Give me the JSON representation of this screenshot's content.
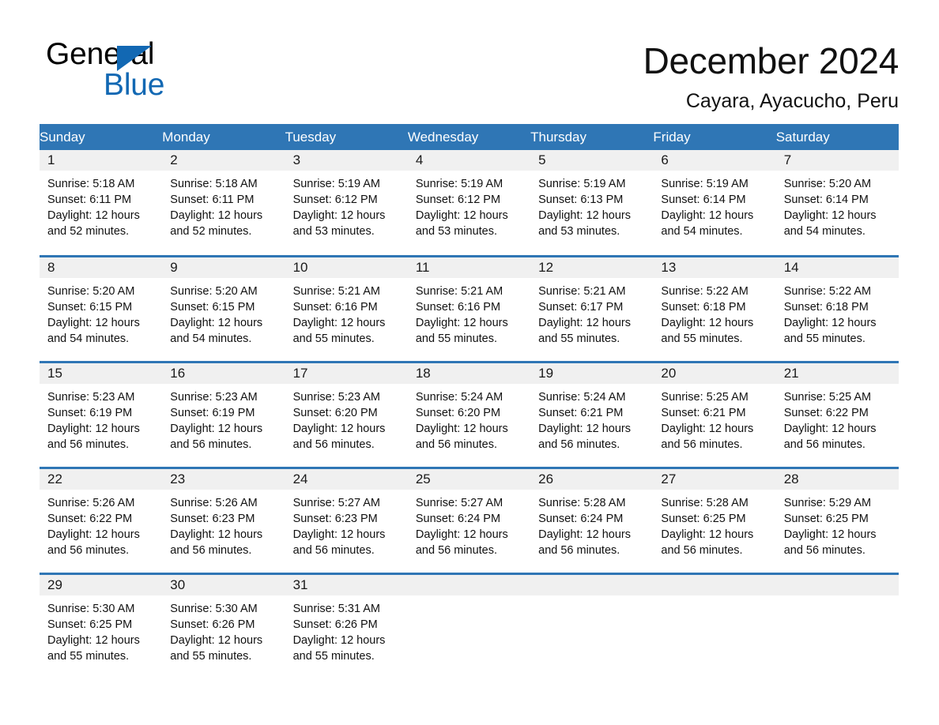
{
  "brand": {
    "logo_text_top": "General",
    "logo_text_bottom": "Blue",
    "logo_icon": "triangle-icon",
    "accent_color": "#1268b3"
  },
  "header": {
    "title": "December 2024",
    "location": "Cayara, Ayacucho, Peru"
  },
  "calendar": {
    "header_bg": "#2f76b5",
    "header_text_color": "#ffffff",
    "daynum_band_bg": "#f0f0f0",
    "weekday_headers": [
      "Sunday",
      "Monday",
      "Tuesday",
      "Wednesday",
      "Thursday",
      "Friday",
      "Saturday"
    ],
    "weeks": [
      [
        {
          "day": "1",
          "sunrise": "Sunrise: 5:18 AM",
          "sunset": "Sunset: 6:11 PM",
          "daylight": "Daylight: 12 hours and 52 minutes."
        },
        {
          "day": "2",
          "sunrise": "Sunrise: 5:18 AM",
          "sunset": "Sunset: 6:11 PM",
          "daylight": "Daylight: 12 hours and 52 minutes."
        },
        {
          "day": "3",
          "sunrise": "Sunrise: 5:19 AM",
          "sunset": "Sunset: 6:12 PM",
          "daylight": "Daylight: 12 hours and 53 minutes."
        },
        {
          "day": "4",
          "sunrise": "Sunrise: 5:19 AM",
          "sunset": "Sunset: 6:12 PM",
          "daylight": "Daylight: 12 hours and 53 minutes."
        },
        {
          "day": "5",
          "sunrise": "Sunrise: 5:19 AM",
          "sunset": "Sunset: 6:13 PM",
          "daylight": "Daylight: 12 hours and 53 minutes."
        },
        {
          "day": "6",
          "sunrise": "Sunrise: 5:19 AM",
          "sunset": "Sunset: 6:14 PM",
          "daylight": "Daylight: 12 hours and 54 minutes."
        },
        {
          "day": "7",
          "sunrise": "Sunrise: 5:20 AM",
          "sunset": "Sunset: 6:14 PM",
          "daylight": "Daylight: 12 hours and 54 minutes."
        }
      ],
      [
        {
          "day": "8",
          "sunrise": "Sunrise: 5:20 AM",
          "sunset": "Sunset: 6:15 PM",
          "daylight": "Daylight: 12 hours and 54 minutes."
        },
        {
          "day": "9",
          "sunrise": "Sunrise: 5:20 AM",
          "sunset": "Sunset: 6:15 PM",
          "daylight": "Daylight: 12 hours and 54 minutes."
        },
        {
          "day": "10",
          "sunrise": "Sunrise: 5:21 AM",
          "sunset": "Sunset: 6:16 PM",
          "daylight": "Daylight: 12 hours and 55 minutes."
        },
        {
          "day": "11",
          "sunrise": "Sunrise: 5:21 AM",
          "sunset": "Sunset: 6:16 PM",
          "daylight": "Daylight: 12 hours and 55 minutes."
        },
        {
          "day": "12",
          "sunrise": "Sunrise: 5:21 AM",
          "sunset": "Sunset: 6:17 PM",
          "daylight": "Daylight: 12 hours and 55 minutes."
        },
        {
          "day": "13",
          "sunrise": "Sunrise: 5:22 AM",
          "sunset": "Sunset: 6:18 PM",
          "daylight": "Daylight: 12 hours and 55 minutes."
        },
        {
          "day": "14",
          "sunrise": "Sunrise: 5:22 AM",
          "sunset": "Sunset: 6:18 PM",
          "daylight": "Daylight: 12 hours and 55 minutes."
        }
      ],
      [
        {
          "day": "15",
          "sunrise": "Sunrise: 5:23 AM",
          "sunset": "Sunset: 6:19 PM",
          "daylight": "Daylight: 12 hours and 56 minutes."
        },
        {
          "day": "16",
          "sunrise": "Sunrise: 5:23 AM",
          "sunset": "Sunset: 6:19 PM",
          "daylight": "Daylight: 12 hours and 56 minutes."
        },
        {
          "day": "17",
          "sunrise": "Sunrise: 5:23 AM",
          "sunset": "Sunset: 6:20 PM",
          "daylight": "Daylight: 12 hours and 56 minutes."
        },
        {
          "day": "18",
          "sunrise": "Sunrise: 5:24 AM",
          "sunset": "Sunset: 6:20 PM",
          "daylight": "Daylight: 12 hours and 56 minutes."
        },
        {
          "day": "19",
          "sunrise": "Sunrise: 5:24 AM",
          "sunset": "Sunset: 6:21 PM",
          "daylight": "Daylight: 12 hours and 56 minutes."
        },
        {
          "day": "20",
          "sunrise": "Sunrise: 5:25 AM",
          "sunset": "Sunset: 6:21 PM",
          "daylight": "Daylight: 12 hours and 56 minutes."
        },
        {
          "day": "21",
          "sunrise": "Sunrise: 5:25 AM",
          "sunset": "Sunset: 6:22 PM",
          "daylight": "Daylight: 12 hours and 56 minutes."
        }
      ],
      [
        {
          "day": "22",
          "sunrise": "Sunrise: 5:26 AM",
          "sunset": "Sunset: 6:22 PM",
          "daylight": "Daylight: 12 hours and 56 minutes."
        },
        {
          "day": "23",
          "sunrise": "Sunrise: 5:26 AM",
          "sunset": "Sunset: 6:23 PM",
          "daylight": "Daylight: 12 hours and 56 minutes."
        },
        {
          "day": "24",
          "sunrise": "Sunrise: 5:27 AM",
          "sunset": "Sunset: 6:23 PM",
          "daylight": "Daylight: 12 hours and 56 minutes."
        },
        {
          "day": "25",
          "sunrise": "Sunrise: 5:27 AM",
          "sunset": "Sunset: 6:24 PM",
          "daylight": "Daylight: 12 hours and 56 minutes."
        },
        {
          "day": "26",
          "sunrise": "Sunrise: 5:28 AM",
          "sunset": "Sunset: 6:24 PM",
          "daylight": "Daylight: 12 hours and 56 minutes."
        },
        {
          "day": "27",
          "sunrise": "Sunrise: 5:28 AM",
          "sunset": "Sunset: 6:25 PM",
          "daylight": "Daylight: 12 hours and 56 minutes."
        },
        {
          "day": "28",
          "sunrise": "Sunrise: 5:29 AM",
          "sunset": "Sunset: 6:25 PM",
          "daylight": "Daylight: 12 hours and 56 minutes."
        }
      ],
      [
        {
          "day": "29",
          "sunrise": "Sunrise: 5:30 AM",
          "sunset": "Sunset: 6:25 PM",
          "daylight": "Daylight: 12 hours and 55 minutes."
        },
        {
          "day": "30",
          "sunrise": "Sunrise: 5:30 AM",
          "sunset": "Sunset: 6:26 PM",
          "daylight": "Daylight: 12 hours and 55 minutes."
        },
        {
          "day": "31",
          "sunrise": "Sunrise: 5:31 AM",
          "sunset": "Sunset: 6:26 PM",
          "daylight": "Daylight: 12 hours and 55 minutes."
        },
        {
          "day": "",
          "sunrise": "",
          "sunset": "",
          "daylight": ""
        },
        {
          "day": "",
          "sunrise": "",
          "sunset": "",
          "daylight": ""
        },
        {
          "day": "",
          "sunrise": "",
          "sunset": "",
          "daylight": ""
        },
        {
          "day": "",
          "sunrise": "",
          "sunset": "",
          "daylight": ""
        }
      ]
    ]
  }
}
